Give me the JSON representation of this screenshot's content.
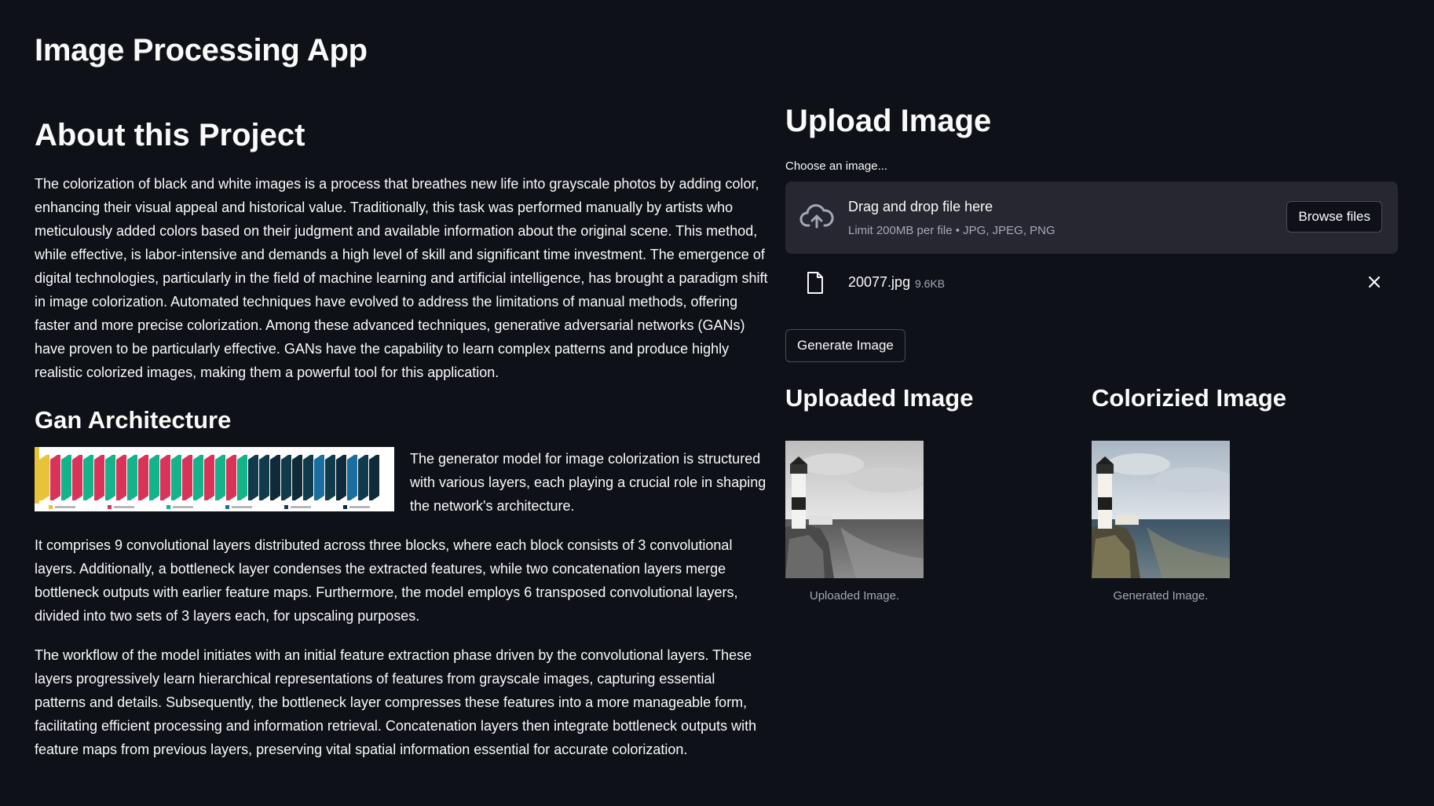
{
  "app": {
    "title": "Image Processing App"
  },
  "about": {
    "heading": "About this Project",
    "paragraph": "The colorization of black and white images is a process that breathes new life into grayscale photos by adding color, enhancing their visual appeal and historical value. Traditionally, this task was performed manually by artists who meticulously added colors based on their judgment and available information about the original scene. This method, while effective, is labor-intensive and demands a high level of skill and significant time investment. The emergence of digital technologies, particularly in the field of machine learning and artificial intelligence, has brought a paradigm shift in image colorization. Automated techniques have evolved to address the limitations of manual methods, offering faster and more precise colorization. Among these advanced techniques, generative adversarial networks (GANs) have proven to be particularly effective. GANs have the capability to learn complex patterns and produce highly realistic colorized images, making them a powerful tool for this application."
  },
  "gan": {
    "heading": "Gan Architecture",
    "intro": "The generator model for image colorization is structured with various layers, each playing a crucial role in shaping the network's architecture.",
    "paragraph1": "It comprises 9 convolutional layers distributed across three blocks, where each block consists of 3 convolutional layers. Additionally, a bottleneck layer condenses the extracted features, while two concatenation layers merge bottleneck outputs with earlier feature maps. Furthermore, the model employs 6 transposed convolutional layers, divided into two sets of 3 layers each, for upscaling purposes.",
    "paragraph2": "The workflow of the model initiates with an initial feature extraction phase driven by the convolutional layers. These layers progressively learn hierarchical representations of features from grayscale images, capturing essential patterns and details. Subsequently, the bottleneck layer compresses these features into a more manageable form, facilitating efficient processing and information retrieval. Concatenation layers then integrate bottleneck outputs with feature maps from previous layers, preserving vital spatial information essential for accurate colorization.",
    "figure_colors": [
      "#e8c33a",
      "#d9335a",
      "#14b38a",
      "#1a6fa0",
      "#123a4d",
      "#0f2a38"
    ]
  },
  "upload": {
    "heading": "Upload Image",
    "label": "Choose an image...",
    "drop_title": "Drag and drop file here",
    "drop_limit": "Limit 200MB per file • JPG, JPEG, PNG",
    "browse_label": "Browse files",
    "file": {
      "name": "20077.jpg",
      "size": "9.6KB"
    },
    "generate_label": "Generate Image"
  },
  "results": {
    "uploaded": {
      "heading": "Uploaded Image",
      "caption": "Uploaded Image."
    },
    "colorized": {
      "heading": "Colorizied Image",
      "caption": "Generated Image."
    }
  },
  "colors": {
    "background": "#0e1117",
    "dropzone": "#262730",
    "muted_text": "#a3a8b8"
  }
}
